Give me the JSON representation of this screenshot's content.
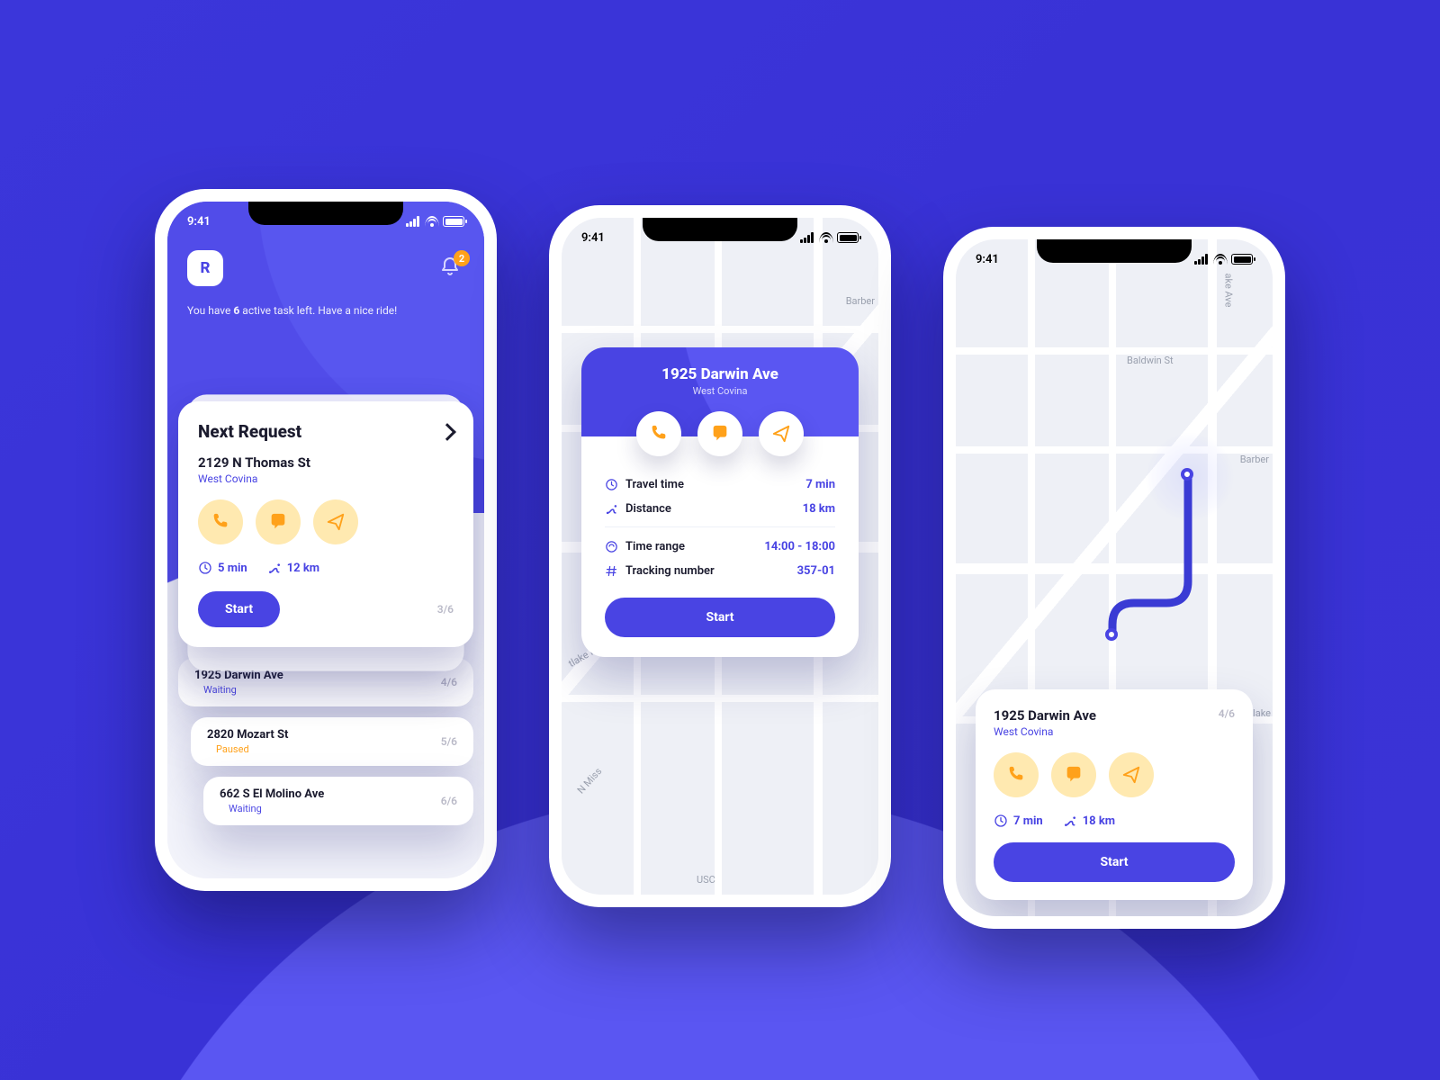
{
  "status": {
    "time": "9:41"
  },
  "screen1": {
    "avatar_initial": "R",
    "notif_count": "2",
    "welcome_pre": "You have ",
    "welcome_bold": "6",
    "welcome_post": " active task left. Have a nice ride!",
    "next_title": "Next Request",
    "address": "2129 N Thomas St",
    "city": "West Covina",
    "travel_time": "5 min",
    "distance": "12 km",
    "start": "Start",
    "count": "3/6",
    "tasks": [
      {
        "addr": "1925 Darwin Ave",
        "status": "Waiting",
        "count": "4/6"
      },
      {
        "addr": "2820 Mozart St",
        "status": "Paused",
        "count": "5/6"
      },
      {
        "addr": "662 S El Molino Ave",
        "status": "Waiting",
        "count": "6/6"
      }
    ]
  },
  "screen2": {
    "address": "1925 Darwin Ave",
    "city": "West Covina",
    "rows": {
      "travel_label": "Travel time",
      "travel_value": "7 min",
      "distance_label": "Distance",
      "distance_value": "18 km",
      "range_label": "Time range",
      "range_value": "14:00 - 18:00",
      "tracking_label": "Tracking number",
      "tracking_value": "357-01"
    },
    "start": "Start",
    "map_labels": {
      "barber": "Barber",
      "road": "tlake Rd",
      "miss": "N Miss",
      "usc": "USC"
    }
  },
  "screen3": {
    "address": "1925 Darwin Ave",
    "city": "West Covina",
    "count": "4/6",
    "travel_time": "7 min",
    "distance": "18 km",
    "start": "Start",
    "map_labels": {
      "ave": "ake Ave",
      "baldwin": "Baldwin St",
      "barber": "Barber",
      "lake": "tlake"
    }
  },
  "icons": {
    "phone": "phone-icon",
    "chat": "chat-icon",
    "nav": "navigate-icon",
    "clock": "clock-icon",
    "route": "route-icon",
    "hash": "hash-icon",
    "range": "time-range-icon"
  }
}
